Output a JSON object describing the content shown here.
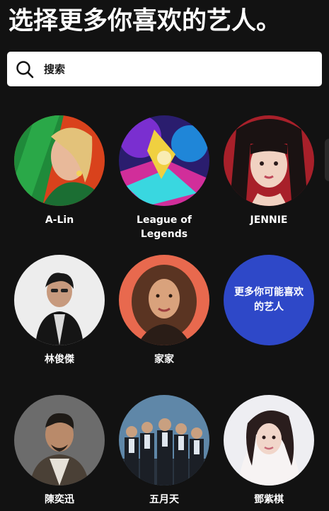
{
  "header": {
    "title": "选择更多你喜欢的艺人。"
  },
  "search": {
    "placeholder": "搜索"
  },
  "artists": [
    {
      "name": "A-Lin"
    },
    {
      "name": "League of Legends"
    },
    {
      "name": "JENNIE"
    },
    {
      "name": "林俊傑"
    },
    {
      "name": "家家"
    },
    {
      "name": "陳奕迅"
    },
    {
      "name": "五月天"
    },
    {
      "name": "鄧紫棋"
    }
  ],
  "more_artists": {
    "label": "更多你可能喜欢的艺人"
  },
  "colors": {
    "background": "#121212",
    "more_circle": "#2e48c8",
    "search_bg": "#ffffff"
  }
}
